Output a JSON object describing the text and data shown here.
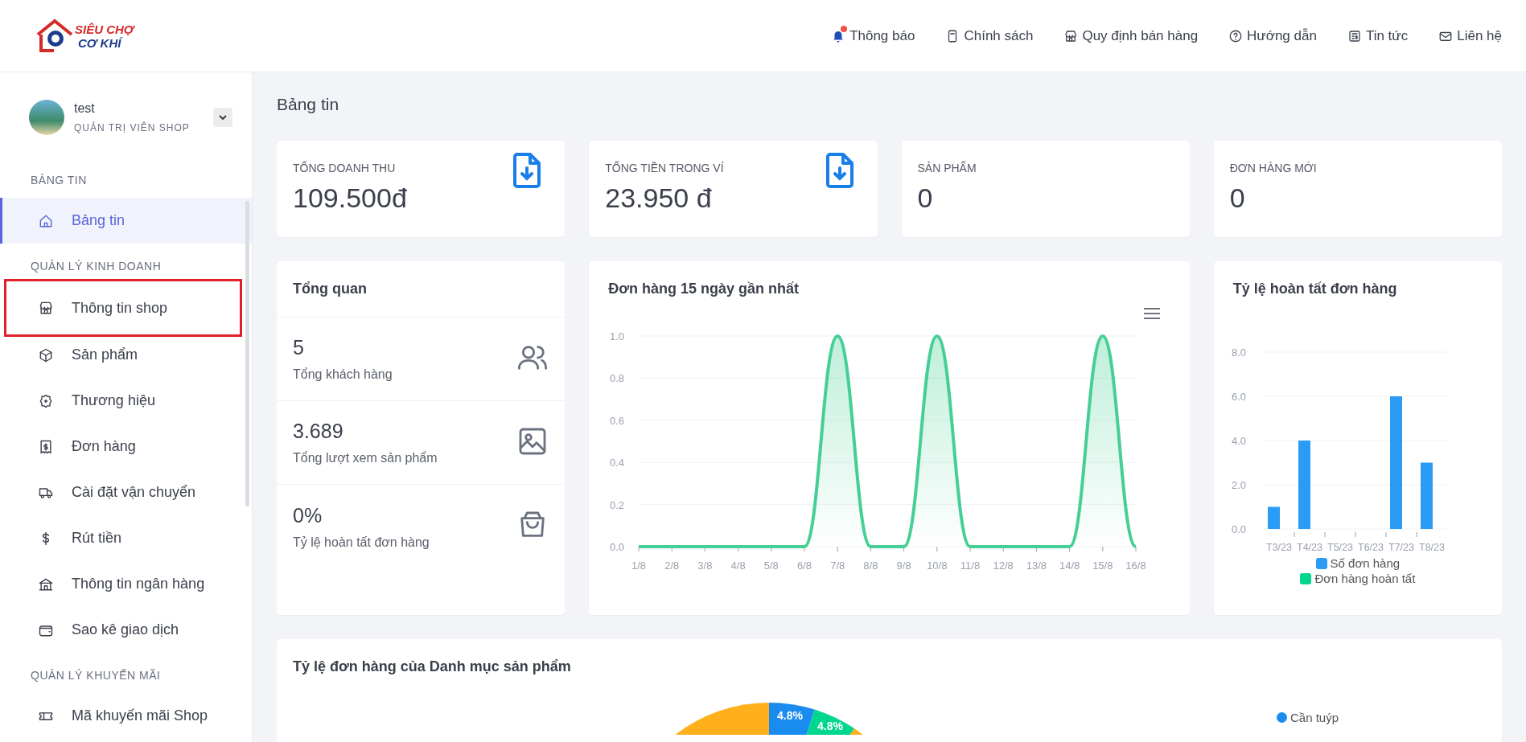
{
  "header": {
    "logo": {
      "line_1": "SIÊU CHỢ",
      "line_2": "CƠ KHÍ"
    },
    "nav": [
      {
        "label": "Thông báo",
        "kind": "bell",
        "alert": true
      },
      {
        "label": "Chính sách",
        "kind": "book",
        "alert": false
      },
      {
        "label": "Quy định bán hàng",
        "kind": "store",
        "alert": false
      },
      {
        "label": "Hướng dẫn",
        "kind": "help",
        "alert": false
      },
      {
        "label": "Tin tức",
        "kind": "news",
        "alert": false
      },
      {
        "label": "Liên hệ",
        "kind": "mail",
        "alert": false
      }
    ]
  },
  "sidebar": {
    "user": {
      "name": "test",
      "role": "QUẢN TRỊ VIÊN SHOP"
    },
    "sections": [
      {
        "title": "BẢNG TIN",
        "items": [
          {
            "label": "Bảng tin",
            "kind": "home",
            "selected": true,
            "highlighted": false
          }
        ]
      },
      {
        "title": "QUẢN LÝ KINH DOANH",
        "items": [
          {
            "label": "Thông tin shop",
            "kind": "store",
            "selected": false,
            "highlighted": true
          },
          {
            "label": "Sản phẩm",
            "kind": "box",
            "selected": false,
            "highlighted": false
          },
          {
            "label": "Thương hiệu",
            "kind": "badge",
            "selected": false,
            "highlighted": false
          },
          {
            "label": "Đơn hàng",
            "kind": "receipt",
            "selected": false,
            "highlighted": false
          },
          {
            "label": "Cài đặt vận chuyển",
            "kind": "truck",
            "selected": false,
            "highlighted": false
          },
          {
            "label": "Rút tiền",
            "kind": "dollar",
            "selected": false,
            "highlighted": false
          },
          {
            "label": "Thông tin ngân hàng",
            "kind": "bank",
            "selected": false,
            "highlighted": false
          },
          {
            "label": "Sao kê giao dịch",
            "kind": "wallet",
            "selected": false,
            "highlighted": false
          }
        ]
      },
      {
        "title": "QUẢN LÝ KHUYẾN MÃI",
        "items": [
          {
            "label": "Mã khuyến mãi Shop",
            "kind": "ticket",
            "selected": false,
            "highlighted": false
          }
        ]
      }
    ]
  },
  "page_title": "Bảng tin",
  "stats": [
    {
      "label": "TỔNG DOANH THU",
      "value": "109.500đ",
      "download_icon": true
    },
    {
      "label": "TỔNG TIỀN TRONG VÍ",
      "value": "23.950 đ",
      "download_icon": true
    },
    {
      "label": "SẢN PHẨM",
      "value": "0",
      "download_icon": false
    },
    {
      "label": "ĐƠN HÀNG MỚI",
      "value": "0",
      "download_icon": false
    }
  ],
  "overview": {
    "title": "Tổng quan",
    "rows": [
      {
        "value": "5",
        "label": "Tổng khách hàng",
        "kind": "users"
      },
      {
        "value": "3.689",
        "label": "Tổng lượt xem sản phẩm",
        "kind": "image"
      },
      {
        "value": "0%",
        "label": "Tỷ lệ hoàn tất đơn hàng",
        "kind": "bag"
      }
    ]
  },
  "orders_chart": {
    "chart_data": {
      "type": "area",
      "title": "Đơn hàng 15 ngày gần nhất",
      "categories": [
        "1/8",
        "2/8",
        "3/8",
        "4/8",
        "5/8",
        "6/8",
        "7/8",
        "8/8",
        "9/8",
        "10/8",
        "11/8",
        "12/8",
        "13/8",
        "14/8",
        "15/8",
        "16/8"
      ],
      "grid": true,
      "series": [
        {
          "color": "#46cf95",
          "values": [
            0,
            0,
            0,
            0,
            0,
            0,
            1,
            0,
            0,
            1,
            0,
            0,
            0,
            0,
            1,
            0
          ]
        }
      ],
      "ylim": [
        0,
        1
      ],
      "yticks": [
        {
          "value": 0,
          "label": "0.0"
        },
        {
          "value": 0.2,
          "label": "0.2"
        },
        {
          "value": 0.4,
          "label": "0.4"
        },
        {
          "value": 0.6,
          "label": "0.6"
        },
        {
          "value": 0.8,
          "label": "0.8"
        },
        {
          "value": 1,
          "label": "1.0"
        }
      ]
    }
  },
  "completion_chart": {
    "chart_data": {
      "type": "bar",
      "title": "Tỷ lệ hoàn tất đơn hàng",
      "categories": [
        "T3/23",
        "T4/23",
        "T5/23",
        "T6/23",
        "T7/23",
        "T8/23"
      ],
      "grid": true,
      "series": [
        {
          "name": "Số đơn hàng",
          "color": "#2b9cf5",
          "values": [
            1,
            4,
            0,
            0,
            6,
            3
          ]
        },
        {
          "name": "Đơn hàng hoàn tất",
          "color": "#00d68f",
          "values": [
            0,
            0,
            0,
            0,
            0,
            0
          ]
        }
      ],
      "ylim": [
        0,
        8
      ],
      "yticks": [
        {
          "value": 0,
          "label": "0.0"
        },
        {
          "value": 2,
          "label": "2.0"
        },
        {
          "value": 4,
          "label": "4.0"
        },
        {
          "value": 6,
          "label": "6.0"
        },
        {
          "value": 8,
          "label": "8.0"
        }
      ]
    }
  },
  "category_share": {
    "title": "Tỷ lệ đơn hàng của Danh mục sản phẩm",
    "slice_labels": [
      {
        "label": "4.8%",
        "color": "#1a8cf0"
      },
      {
        "label": "4.8%",
        "color": "#00d68f"
      }
    ],
    "legend": [
      {
        "label": "Cần tuýp",
        "color": "#1a8cf0"
      }
    ]
  }
}
